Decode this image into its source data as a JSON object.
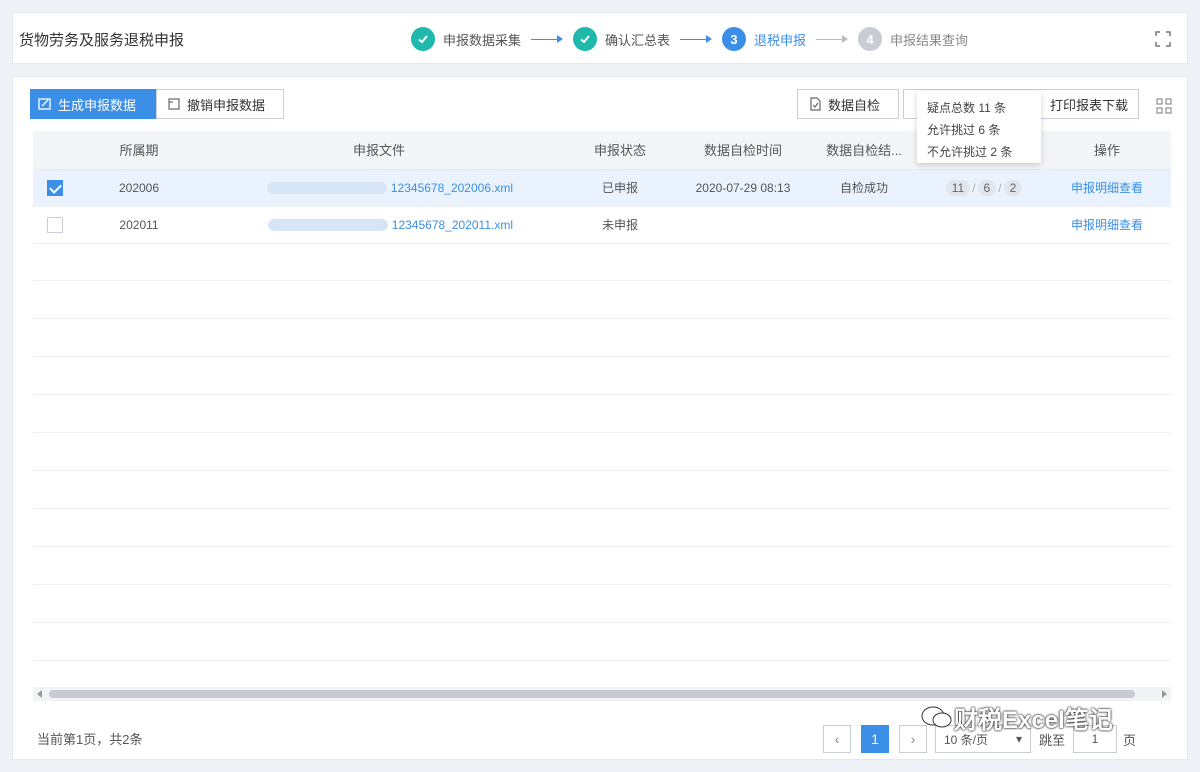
{
  "header": {
    "title": "货物劳务及服务退税申报",
    "steps": [
      {
        "label": "申报数据采集",
        "state": "done"
      },
      {
        "label": "确认汇总表",
        "state": "done"
      },
      {
        "label": "退税申报",
        "state": "current",
        "number": "3"
      },
      {
        "label": "申报结果查询",
        "state": "todo",
        "number": "4"
      }
    ]
  },
  "toolbar": {
    "generate_label": "生成申报数据",
    "revoke_label": "撤销申报数据",
    "self_check_label": "数据自检",
    "print_label": "打印报表下载"
  },
  "tooltip": {
    "line1": "疑点总数 11 条",
    "line2": "允许挑过 6 条",
    "line3": "不允许挑过 2 条"
  },
  "table": {
    "headers": [
      "所属期",
      "申报文件",
      "申报状态",
      "数据自检时间",
      "数据自检结...",
      "",
      "操作"
    ],
    "rows": [
      {
        "selected": true,
        "period": "202006",
        "file": "12345678_202006.xml",
        "status": "已申报",
        "check_time": "2020-07-29 08:13",
        "check_result": "自检成功",
        "counts": [
          "11",
          "6",
          "2"
        ],
        "action": "申报明细查看"
      },
      {
        "selected": false,
        "period": "202011",
        "file": "12345678_202011.xml",
        "status": "未申报",
        "check_time": "",
        "check_result": "",
        "counts": [],
        "action": "申报明细查看"
      }
    ]
  },
  "footer": {
    "summary": "当前第1页，共2条",
    "current_page": "1",
    "page_size": "10 条/页",
    "goto_label": "跳至",
    "goto_value": "1",
    "page_suffix": "页"
  },
  "watermark": {
    "text": "财税Excel笔记"
  },
  "colors": {
    "accent": "#3b8fe6",
    "done": "#1fb8ad",
    "todo": "#c8ccd3"
  }
}
